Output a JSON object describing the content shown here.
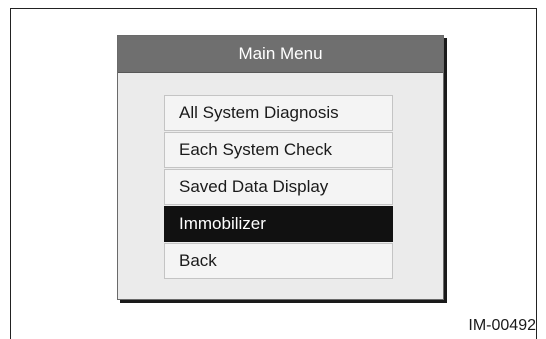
{
  "screen": {
    "title": "Main Menu",
    "menu_items": [
      {
        "label": "All System Diagnosis",
        "selected": false
      },
      {
        "label": "Each System Check",
        "selected": false
      },
      {
        "label": "Saved Data Display",
        "selected": false
      },
      {
        "label": "Immobilizer",
        "selected": true
      },
      {
        "label": "Back",
        "selected": false
      }
    ]
  },
  "figure_id": "IM-00492",
  "colors": {
    "title_bar": "#6f6f6f",
    "screen_background": "#ebebeb",
    "selected_item": "#111111",
    "item_background": "#f4f4f4"
  }
}
